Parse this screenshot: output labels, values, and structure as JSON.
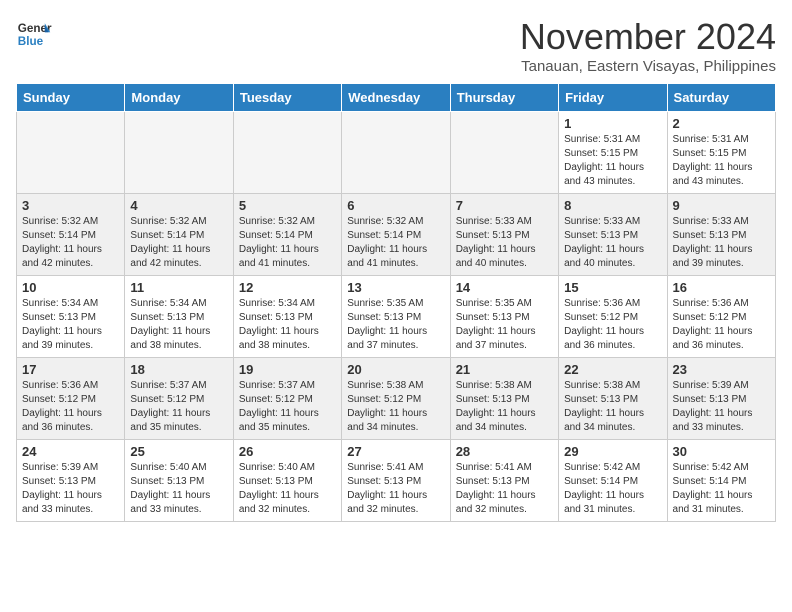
{
  "logo": {
    "line1": "General",
    "line2": "Blue"
  },
  "title": "November 2024",
  "location": "Tanauan, Eastern Visayas, Philippines",
  "weekdays": [
    "Sunday",
    "Monday",
    "Tuesday",
    "Wednesday",
    "Thursday",
    "Friday",
    "Saturday"
  ],
  "weeks": [
    [
      {
        "day": "",
        "info": ""
      },
      {
        "day": "",
        "info": ""
      },
      {
        "day": "",
        "info": ""
      },
      {
        "day": "",
        "info": ""
      },
      {
        "day": "",
        "info": ""
      },
      {
        "day": "1",
        "info": "Sunrise: 5:31 AM\nSunset: 5:15 PM\nDaylight: 11 hours\nand 43 minutes."
      },
      {
        "day": "2",
        "info": "Sunrise: 5:31 AM\nSunset: 5:15 PM\nDaylight: 11 hours\nand 43 minutes."
      }
    ],
    [
      {
        "day": "3",
        "info": "Sunrise: 5:32 AM\nSunset: 5:14 PM\nDaylight: 11 hours\nand 42 minutes."
      },
      {
        "day": "4",
        "info": "Sunrise: 5:32 AM\nSunset: 5:14 PM\nDaylight: 11 hours\nand 42 minutes."
      },
      {
        "day": "5",
        "info": "Sunrise: 5:32 AM\nSunset: 5:14 PM\nDaylight: 11 hours\nand 41 minutes."
      },
      {
        "day": "6",
        "info": "Sunrise: 5:32 AM\nSunset: 5:14 PM\nDaylight: 11 hours\nand 41 minutes."
      },
      {
        "day": "7",
        "info": "Sunrise: 5:33 AM\nSunset: 5:13 PM\nDaylight: 11 hours\nand 40 minutes."
      },
      {
        "day": "8",
        "info": "Sunrise: 5:33 AM\nSunset: 5:13 PM\nDaylight: 11 hours\nand 40 minutes."
      },
      {
        "day": "9",
        "info": "Sunrise: 5:33 AM\nSunset: 5:13 PM\nDaylight: 11 hours\nand 39 minutes."
      }
    ],
    [
      {
        "day": "10",
        "info": "Sunrise: 5:34 AM\nSunset: 5:13 PM\nDaylight: 11 hours\nand 39 minutes."
      },
      {
        "day": "11",
        "info": "Sunrise: 5:34 AM\nSunset: 5:13 PM\nDaylight: 11 hours\nand 38 minutes."
      },
      {
        "day": "12",
        "info": "Sunrise: 5:34 AM\nSunset: 5:13 PM\nDaylight: 11 hours\nand 38 minutes."
      },
      {
        "day": "13",
        "info": "Sunrise: 5:35 AM\nSunset: 5:13 PM\nDaylight: 11 hours\nand 37 minutes."
      },
      {
        "day": "14",
        "info": "Sunrise: 5:35 AM\nSunset: 5:13 PM\nDaylight: 11 hours\nand 37 minutes."
      },
      {
        "day": "15",
        "info": "Sunrise: 5:36 AM\nSunset: 5:12 PM\nDaylight: 11 hours\nand 36 minutes."
      },
      {
        "day": "16",
        "info": "Sunrise: 5:36 AM\nSunset: 5:12 PM\nDaylight: 11 hours\nand 36 minutes."
      }
    ],
    [
      {
        "day": "17",
        "info": "Sunrise: 5:36 AM\nSunset: 5:12 PM\nDaylight: 11 hours\nand 36 minutes."
      },
      {
        "day": "18",
        "info": "Sunrise: 5:37 AM\nSunset: 5:12 PM\nDaylight: 11 hours\nand 35 minutes."
      },
      {
        "day": "19",
        "info": "Sunrise: 5:37 AM\nSunset: 5:12 PM\nDaylight: 11 hours\nand 35 minutes."
      },
      {
        "day": "20",
        "info": "Sunrise: 5:38 AM\nSunset: 5:12 PM\nDaylight: 11 hours\nand 34 minutes."
      },
      {
        "day": "21",
        "info": "Sunrise: 5:38 AM\nSunset: 5:13 PM\nDaylight: 11 hours\nand 34 minutes."
      },
      {
        "day": "22",
        "info": "Sunrise: 5:38 AM\nSunset: 5:13 PM\nDaylight: 11 hours\nand 34 minutes."
      },
      {
        "day": "23",
        "info": "Sunrise: 5:39 AM\nSunset: 5:13 PM\nDaylight: 11 hours\nand 33 minutes."
      }
    ],
    [
      {
        "day": "24",
        "info": "Sunrise: 5:39 AM\nSunset: 5:13 PM\nDaylight: 11 hours\nand 33 minutes."
      },
      {
        "day": "25",
        "info": "Sunrise: 5:40 AM\nSunset: 5:13 PM\nDaylight: 11 hours\nand 33 minutes."
      },
      {
        "day": "26",
        "info": "Sunrise: 5:40 AM\nSunset: 5:13 PM\nDaylight: 11 hours\nand 32 minutes."
      },
      {
        "day": "27",
        "info": "Sunrise: 5:41 AM\nSunset: 5:13 PM\nDaylight: 11 hours\nand 32 minutes."
      },
      {
        "day": "28",
        "info": "Sunrise: 5:41 AM\nSunset: 5:13 PM\nDaylight: 11 hours\nand 32 minutes."
      },
      {
        "day": "29",
        "info": "Sunrise: 5:42 AM\nSunset: 5:14 PM\nDaylight: 11 hours\nand 31 minutes."
      },
      {
        "day": "30",
        "info": "Sunrise: 5:42 AM\nSunset: 5:14 PM\nDaylight: 11 hours\nand 31 minutes."
      }
    ]
  ]
}
